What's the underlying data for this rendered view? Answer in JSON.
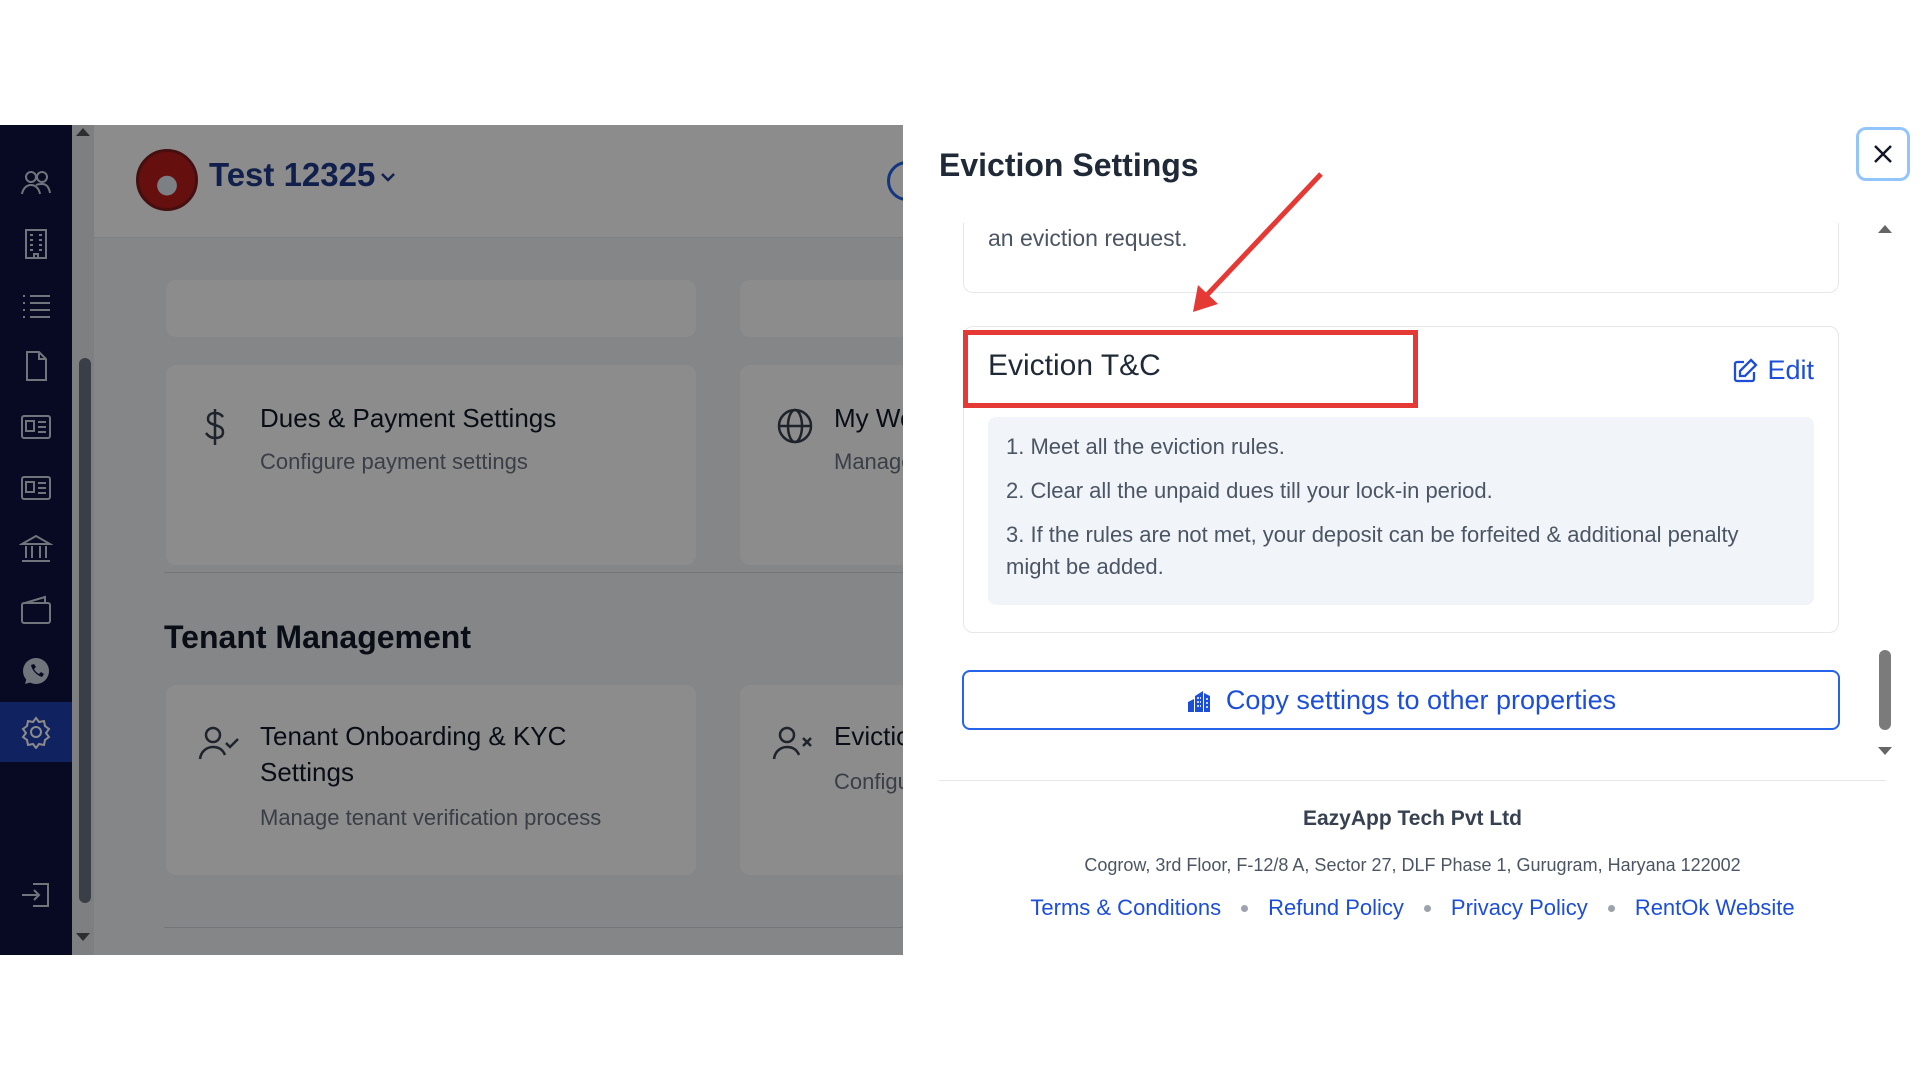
{
  "background_app": {
    "property": {
      "name": "Test 12325"
    },
    "cards": {
      "dues": {
        "title": "Dues & Payment Settings",
        "subtitle": "Configure payment settings"
      },
      "website": {
        "title": "My Website",
        "subtitle": "Manage"
      },
      "onboarding": {
        "title_line1": "Tenant Onboarding & KYC",
        "title_line2": "Settings",
        "subtitle": "Manage tenant verification process"
      },
      "eviction": {
        "title": "Eviction",
        "subtitle": "Configure"
      }
    },
    "section_title": "Tenant Management"
  },
  "panel": {
    "title": "Eviction Settings",
    "previous_text": "an eviction request.",
    "tc": {
      "title": "Eviction T&C",
      "edit_label": "Edit",
      "items": [
        "1. Meet all the eviction rules.",
        "2. Clear all the unpaid dues till your lock-in period.",
        "3. If the rules are not met, your deposit can be forfeited & additional penalty",
        "might be added."
      ]
    },
    "copy_button": "Copy settings to other properties",
    "footer": {
      "company": "EazyApp Tech Pvt Ltd",
      "address": "Cogrow, 3rd Floor, F-12/8 A, Sector 27, DLF Phase 1, Gurugram, Haryana 122002",
      "links": [
        "Terms & Conditions",
        "Refund Policy",
        "Privacy Policy",
        "RentOk Website"
      ]
    }
  },
  "colors": {
    "sidebar": "#0f1340",
    "accent": "#1d4ed8",
    "annotation": "#e53935"
  }
}
